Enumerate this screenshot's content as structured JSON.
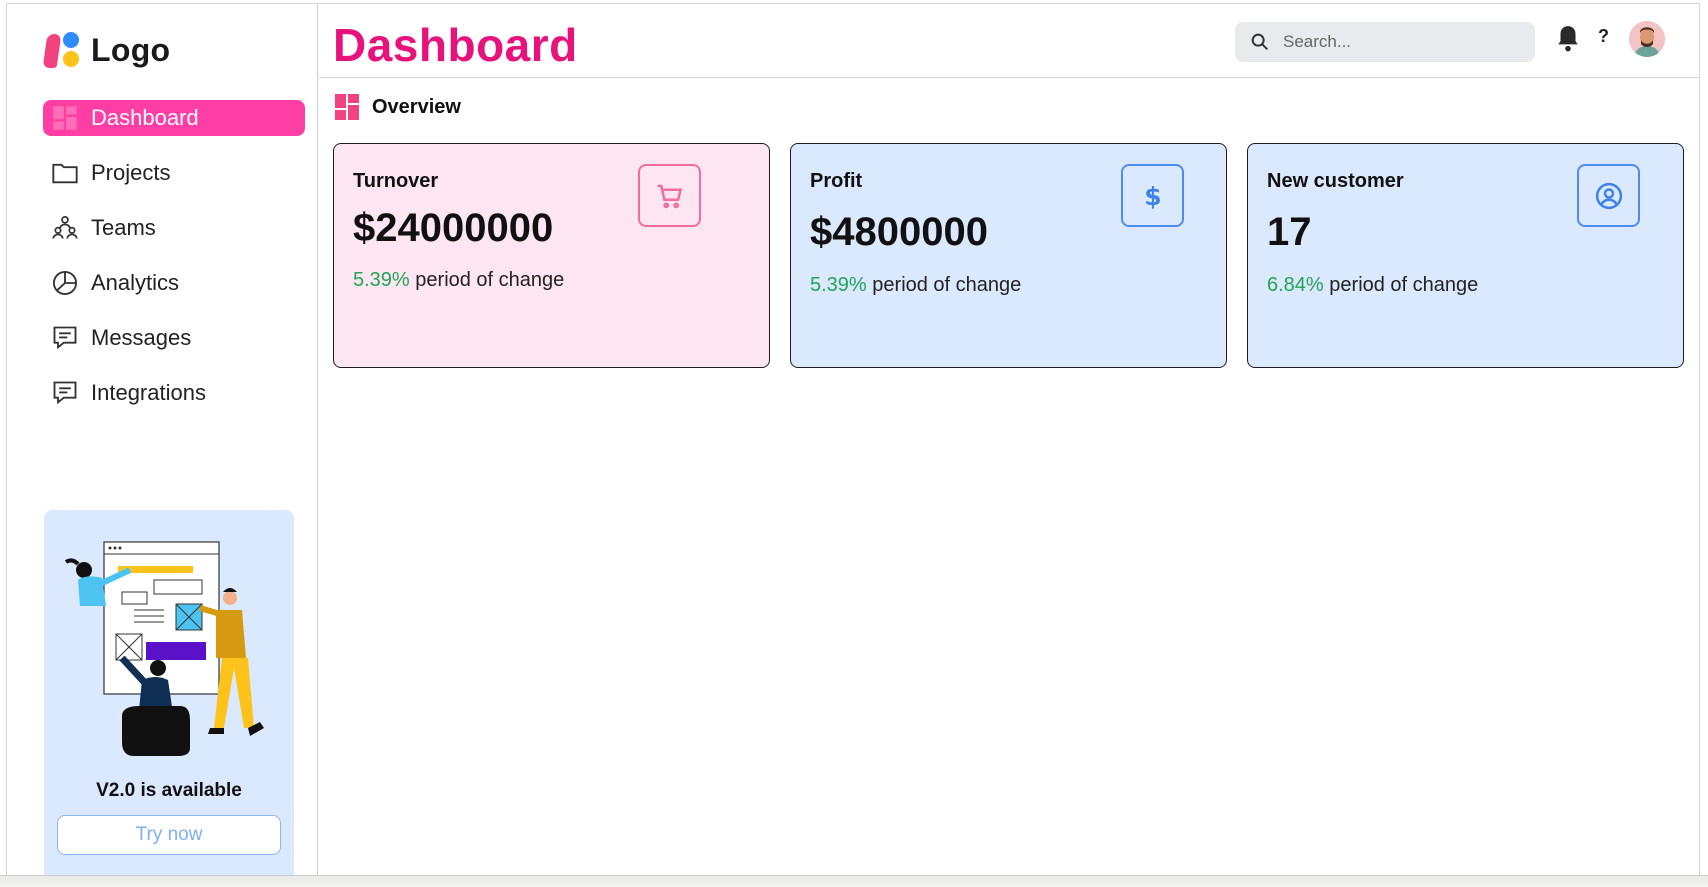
{
  "sidebar": {
    "logo_text": "Logo",
    "items": [
      {
        "label": "Dashboard",
        "icon": "dashboard-grid-icon",
        "active": true
      },
      {
        "label": "Projects",
        "icon": "folder-icon"
      },
      {
        "label": "Teams",
        "icon": "teams-icon"
      },
      {
        "label": "Analytics",
        "icon": "pie-chart-icon"
      },
      {
        "label": "Messages",
        "icon": "message-icon"
      },
      {
        "label": "Integrations",
        "icon": "message-icon"
      }
    ],
    "promo": {
      "title": "V2.0 is available",
      "button_label": "Try now"
    }
  },
  "header": {
    "title": "Dashboard",
    "search_placeholder": "Search...",
    "help_label": "?"
  },
  "overview": {
    "label": "Overview"
  },
  "cards": [
    {
      "title": "Turnover",
      "value": "$24000000",
      "change_pct": "5.39%",
      "change_text": "period of change",
      "icon": "cart-icon",
      "theme": "pink"
    },
    {
      "title": "Profit",
      "value": "$4800000",
      "change_pct": "5.39%",
      "change_text": "period of change",
      "icon": "dollar-icon",
      "theme": "blue"
    },
    {
      "title": "New customer",
      "value": "17",
      "change_pct": "6.84%",
      "change_text": "period of change",
      "icon": "user-circle-icon",
      "theme": "blue"
    }
  ],
  "colors": {
    "brand_pink": "#e8127c",
    "active_nav": "#ff3ea5",
    "pink_card": "#fde6f1",
    "blue_card": "#dbe9ff",
    "positive": "#22a356"
  }
}
